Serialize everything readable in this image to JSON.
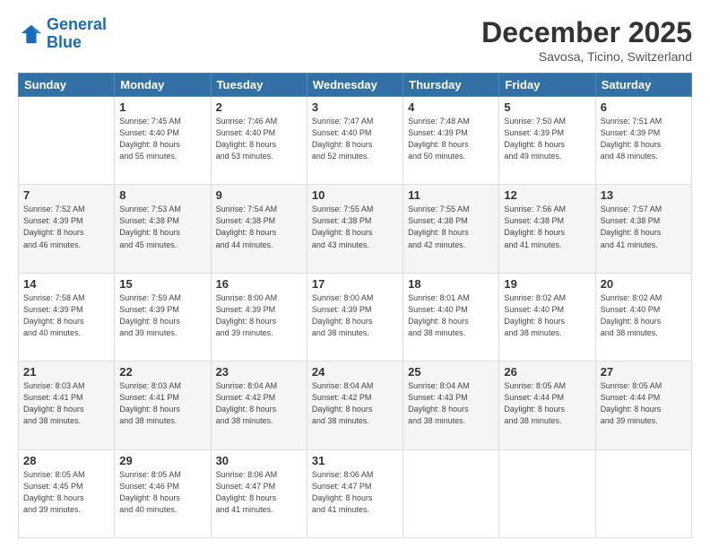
{
  "header": {
    "logo_line1": "General",
    "logo_line2": "Blue",
    "month": "December 2025",
    "location": "Savosa, Ticino, Switzerland"
  },
  "weekdays": [
    "Sunday",
    "Monday",
    "Tuesday",
    "Wednesday",
    "Thursday",
    "Friday",
    "Saturday"
  ],
  "weeks": [
    [
      {
        "day": "",
        "info": ""
      },
      {
        "day": "1",
        "info": "Sunrise: 7:45 AM\nSunset: 4:40 PM\nDaylight: 8 hours\nand 55 minutes."
      },
      {
        "day": "2",
        "info": "Sunrise: 7:46 AM\nSunset: 4:40 PM\nDaylight: 8 hours\nand 53 minutes."
      },
      {
        "day": "3",
        "info": "Sunrise: 7:47 AM\nSunset: 4:40 PM\nDaylight: 8 hours\nand 52 minutes."
      },
      {
        "day": "4",
        "info": "Sunrise: 7:48 AM\nSunset: 4:39 PM\nDaylight: 8 hours\nand 50 minutes."
      },
      {
        "day": "5",
        "info": "Sunrise: 7:50 AM\nSunset: 4:39 PM\nDaylight: 8 hours\nand 49 minutes."
      },
      {
        "day": "6",
        "info": "Sunrise: 7:51 AM\nSunset: 4:39 PM\nDaylight: 8 hours\nand 48 minutes."
      }
    ],
    [
      {
        "day": "7",
        "info": "Sunrise: 7:52 AM\nSunset: 4:39 PM\nDaylight: 8 hours\nand 46 minutes."
      },
      {
        "day": "8",
        "info": "Sunrise: 7:53 AM\nSunset: 4:38 PM\nDaylight: 8 hours\nand 45 minutes."
      },
      {
        "day": "9",
        "info": "Sunrise: 7:54 AM\nSunset: 4:38 PM\nDaylight: 8 hours\nand 44 minutes."
      },
      {
        "day": "10",
        "info": "Sunrise: 7:55 AM\nSunset: 4:38 PM\nDaylight: 8 hours\nand 43 minutes."
      },
      {
        "day": "11",
        "info": "Sunrise: 7:55 AM\nSunset: 4:38 PM\nDaylight: 8 hours\nand 42 minutes."
      },
      {
        "day": "12",
        "info": "Sunrise: 7:56 AM\nSunset: 4:38 PM\nDaylight: 8 hours\nand 41 minutes."
      },
      {
        "day": "13",
        "info": "Sunrise: 7:57 AM\nSunset: 4:38 PM\nDaylight: 8 hours\nand 41 minutes."
      }
    ],
    [
      {
        "day": "14",
        "info": "Sunrise: 7:58 AM\nSunset: 4:39 PM\nDaylight: 8 hours\nand 40 minutes."
      },
      {
        "day": "15",
        "info": "Sunrise: 7:59 AM\nSunset: 4:39 PM\nDaylight: 8 hours\nand 39 minutes."
      },
      {
        "day": "16",
        "info": "Sunrise: 8:00 AM\nSunset: 4:39 PM\nDaylight: 8 hours\nand 39 minutes."
      },
      {
        "day": "17",
        "info": "Sunrise: 8:00 AM\nSunset: 4:39 PM\nDaylight: 8 hours\nand 38 minutes."
      },
      {
        "day": "18",
        "info": "Sunrise: 8:01 AM\nSunset: 4:40 PM\nDaylight: 8 hours\nand 38 minutes."
      },
      {
        "day": "19",
        "info": "Sunrise: 8:02 AM\nSunset: 4:40 PM\nDaylight: 8 hours\nand 38 minutes."
      },
      {
        "day": "20",
        "info": "Sunrise: 8:02 AM\nSunset: 4:40 PM\nDaylight: 8 hours\nand 38 minutes."
      }
    ],
    [
      {
        "day": "21",
        "info": "Sunrise: 8:03 AM\nSunset: 4:41 PM\nDaylight: 8 hours\nand 38 minutes."
      },
      {
        "day": "22",
        "info": "Sunrise: 8:03 AM\nSunset: 4:41 PM\nDaylight: 8 hours\nand 38 minutes."
      },
      {
        "day": "23",
        "info": "Sunrise: 8:04 AM\nSunset: 4:42 PM\nDaylight: 8 hours\nand 38 minutes."
      },
      {
        "day": "24",
        "info": "Sunrise: 8:04 AM\nSunset: 4:42 PM\nDaylight: 8 hours\nand 38 minutes."
      },
      {
        "day": "25",
        "info": "Sunrise: 8:04 AM\nSunset: 4:43 PM\nDaylight: 8 hours\nand 38 minutes."
      },
      {
        "day": "26",
        "info": "Sunrise: 8:05 AM\nSunset: 4:44 PM\nDaylight: 8 hours\nand 38 minutes."
      },
      {
        "day": "27",
        "info": "Sunrise: 8:05 AM\nSunset: 4:44 PM\nDaylight: 8 hours\nand 39 minutes."
      }
    ],
    [
      {
        "day": "28",
        "info": "Sunrise: 8:05 AM\nSunset: 4:45 PM\nDaylight: 8 hours\nand 39 minutes."
      },
      {
        "day": "29",
        "info": "Sunrise: 8:05 AM\nSunset: 4:46 PM\nDaylight: 8 hours\nand 40 minutes."
      },
      {
        "day": "30",
        "info": "Sunrise: 8:06 AM\nSunset: 4:47 PM\nDaylight: 8 hours\nand 41 minutes."
      },
      {
        "day": "31",
        "info": "Sunrise: 8:06 AM\nSunset: 4:47 PM\nDaylight: 8 hours\nand 41 minutes."
      },
      {
        "day": "",
        "info": ""
      },
      {
        "day": "",
        "info": ""
      },
      {
        "day": "",
        "info": ""
      }
    ]
  ]
}
